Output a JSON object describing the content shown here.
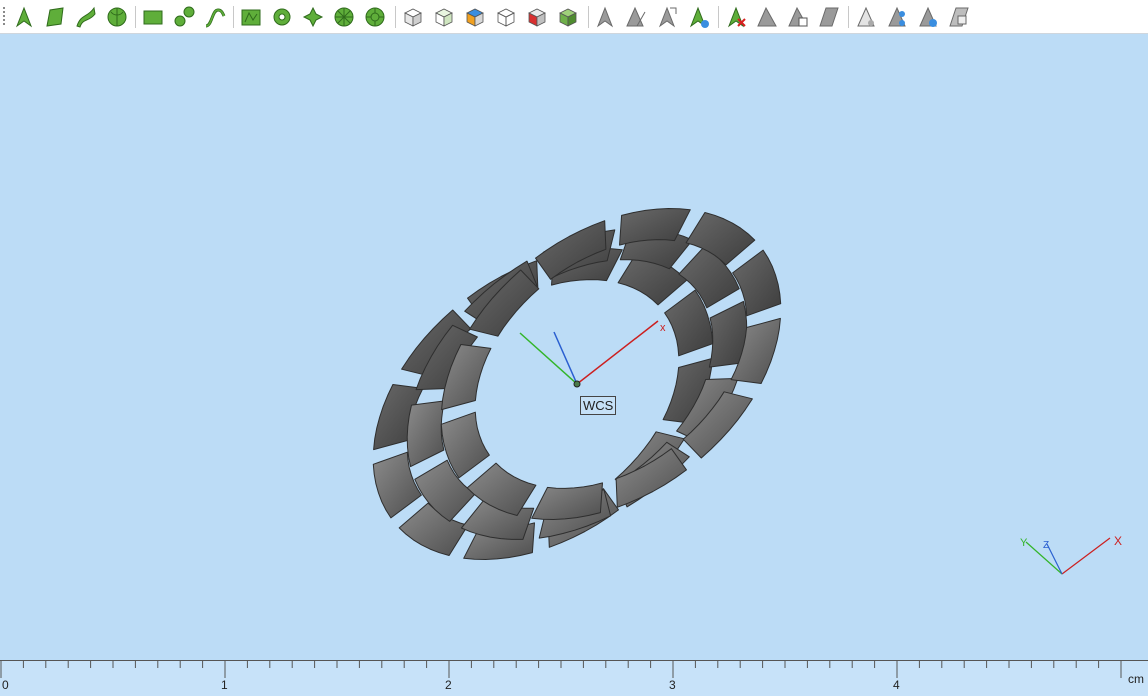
{
  "toolbar": {
    "buttons": [
      {
        "name": "select-icon"
      },
      {
        "name": "select-face-icon"
      },
      {
        "name": "select-edge-icon"
      },
      {
        "name": "select-solid-icon"
      },
      {
        "name": "rectangle-icon"
      },
      {
        "name": "circle-point-icon"
      },
      {
        "name": "curve-icon"
      },
      {
        "name": "polygon-icon"
      },
      {
        "name": "gear-icon"
      },
      {
        "name": "pattern-icon"
      },
      {
        "name": "wheel-icon"
      },
      {
        "name": "spoke-wheel-icon"
      },
      {
        "name": "box-view-icon"
      },
      {
        "name": "box-front-icon"
      },
      {
        "name": "box-color-icon"
      },
      {
        "name": "box-wireframe-icon"
      },
      {
        "name": "box-red-icon"
      },
      {
        "name": "box-green-icon"
      },
      {
        "name": "arrow-gray-icon"
      },
      {
        "name": "arrow-split-icon"
      },
      {
        "name": "arrow-move-icon"
      },
      {
        "name": "arrow-copy-icon"
      },
      {
        "name": "delete-icon"
      },
      {
        "name": "plane-icon"
      },
      {
        "name": "plane-doc-icon"
      },
      {
        "name": "plane-gray-icon"
      },
      {
        "name": "view-hide-icon"
      },
      {
        "name": "view-show-icon"
      },
      {
        "name": "view-eye-icon"
      },
      {
        "name": "view-list-icon"
      }
    ]
  },
  "viewport": {
    "wcs_label": "WCS",
    "axis_x": "x",
    "triad_x": "X",
    "triad_y": "Y",
    "triad_z": "Z"
  },
  "ruler": {
    "labels": [
      "0",
      "1",
      "2",
      "3",
      "4"
    ],
    "unit": "cm"
  }
}
